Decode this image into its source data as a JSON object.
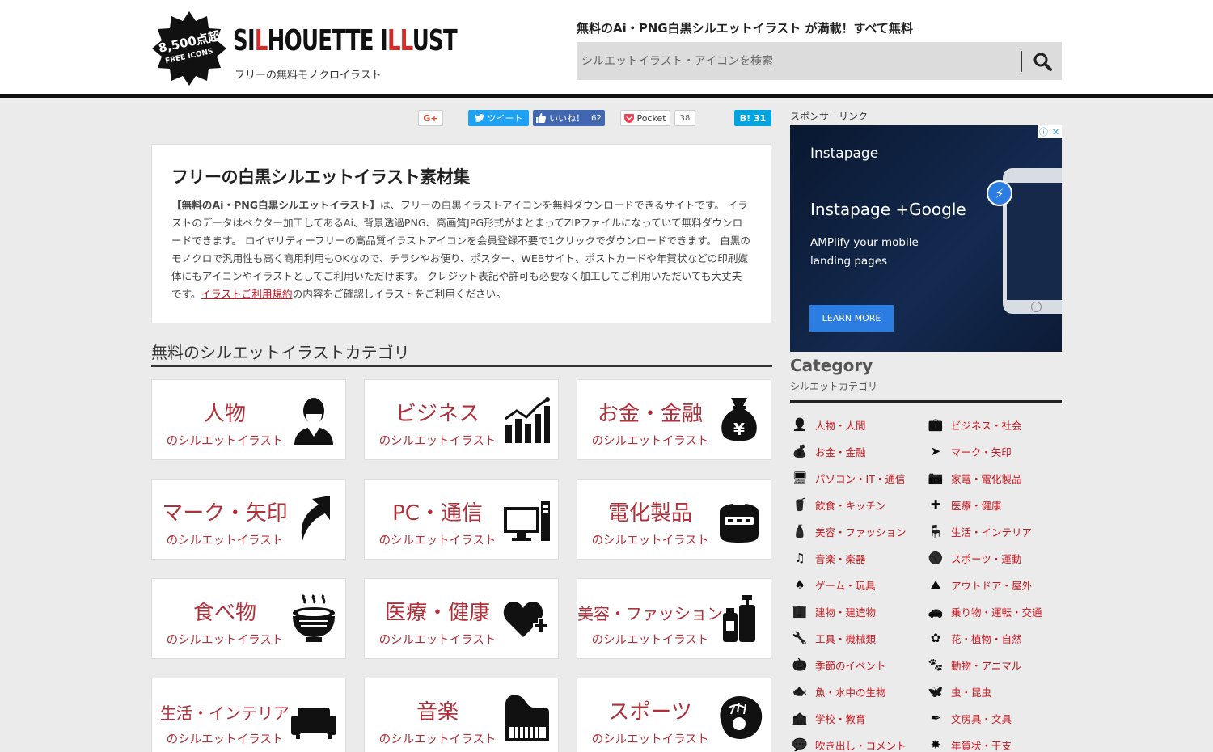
{
  "header": {
    "badge_line1": "8,500点超",
    "badge_line2": "FREE ICONS",
    "logo_parts": [
      "SI",
      "L",
      "HOUETTE I",
      "LL",
      "UST"
    ],
    "logo_sub": "フリーの無料モノクロイラスト",
    "tagline": "無料のAi・PNG白黒シルエットイラスト が満載！すべて無料",
    "search_placeholder": "シルエットイラスト・アイコンを検索"
  },
  "share": {
    "gplus": "G+",
    "tweet": "ツイート",
    "like": "いいね！",
    "like_count": "62",
    "pocket": "Pocket",
    "pocket_count": "38",
    "hatena": "B! 31"
  },
  "intro": {
    "title": "フリーの白黒シルエットイラスト素材集",
    "bold_lead": "【無料のAi・PNG白黒シルエットイラスト】",
    "body_1": "は、フリーの白黒イラストアイコンを無料ダウンロードできるサイトです。 イラストのデータはベクター加工してあるAi、背景透過PNG、高画質JPG形式がまとまってZIPファイルになっていて無料ダウンロードできます。 ロイヤリティーフリーの高品質イラストアイコンを会員登録不要で1クリックでダウンロードできます。 白黒のモノクロで汎用性も高く商用利用もOKなので、チラシやお便り、ポスター、WEBサイト、ポストカードや年賀状などの印刷媒体にもアイコンやイラストとしてご利用いただけます。 クレジット表記や許可も必要なく加工してご利用いただいても大丈夫です。",
    "link": "イラストご利用規約",
    "body_2": "の内容をご確認しイラストをご利用ください。"
  },
  "categories": {
    "heading": "無料のシルエットイラストカテゴリ",
    "subtitle": "のシルエットイラスト",
    "tiles": [
      {
        "name": "人物",
        "icon": "person-icon"
      },
      {
        "name": "ビジネス",
        "icon": "chart-icon"
      },
      {
        "name": "お金・金融",
        "icon": "money-bag-icon"
      },
      {
        "name": "マーク・矢印",
        "icon": "arrow-icon"
      },
      {
        "name": "PC・通信",
        "icon": "computer-icon"
      },
      {
        "name": "電化製品",
        "icon": "rice-cooker-icon"
      },
      {
        "name": "食べ物",
        "icon": "ramen-bowl-icon"
      },
      {
        "name": "医療・健康",
        "icon": "heart-plus-icon"
      },
      {
        "name": "美容・ファッション",
        "icon": "cosmetics-icon"
      },
      {
        "name": "生活・インテリア",
        "icon": "sofa-icon"
      },
      {
        "name": "音楽",
        "icon": "piano-icon"
      },
      {
        "name": "スポーツ",
        "icon": "baseball-glove-icon"
      }
    ]
  },
  "sidebar": {
    "sponsor": "スポンサーリンク",
    "ad": {
      "brand": "Instapage",
      "headline": "Instapage +Google",
      "body": "AMPlify your mobile landing pages",
      "cta": "LEARN MORE"
    },
    "title": "Category",
    "subtitle": "シルエットカテゴリ",
    "items": [
      {
        "label": "人物・人間",
        "icon": "person-icon"
      },
      {
        "label": "ビジネス・社会",
        "icon": "briefcase-icon"
      },
      {
        "label": "お金・金融",
        "icon": "money-bag-icon"
      },
      {
        "label": "マーク・矢印",
        "icon": "arrow-icon"
      },
      {
        "label": "パソコン・IT・通信",
        "icon": "monitor-icon"
      },
      {
        "label": "家電・電化製品",
        "icon": "camera-icon"
      },
      {
        "label": "飲食・キッチン",
        "icon": "cup-icon"
      },
      {
        "label": "医療・健康",
        "icon": "medical-icon"
      },
      {
        "label": "美容・ファッション",
        "icon": "bottle-icon"
      },
      {
        "label": "生活・インテリア",
        "icon": "chair-icon"
      },
      {
        "label": "音楽・楽器",
        "icon": "music-note-icon"
      },
      {
        "label": "スポーツ・運動",
        "icon": "ball-icon"
      },
      {
        "label": "ゲーム・玩具",
        "icon": "spade-icon"
      },
      {
        "label": "アウトドア・屋外",
        "icon": "mountain-icon"
      },
      {
        "label": "建物・建造物",
        "icon": "building-icon"
      },
      {
        "label": "乗り物・運転・交通",
        "icon": "car-icon"
      },
      {
        "label": "工具・機械類",
        "icon": "wrench-icon"
      },
      {
        "label": "花・植物・自然",
        "icon": "flower-icon"
      },
      {
        "label": "季節のイベント",
        "icon": "pumpkin-icon"
      },
      {
        "label": "動物・アニマル",
        "icon": "paw-icon"
      },
      {
        "label": "魚・水中の生物",
        "icon": "fish-icon"
      },
      {
        "label": "虫・昆虫",
        "icon": "butterfly-icon"
      },
      {
        "label": "学校・教育",
        "icon": "school-icon"
      },
      {
        "label": "文房具・文具",
        "icon": "pen-icon"
      },
      {
        "label": "吹き出し・コメント",
        "icon": "speech-bubble-icon"
      },
      {
        "label": "年賀状・干支",
        "icon": "new-year-icon"
      }
    ]
  }
}
